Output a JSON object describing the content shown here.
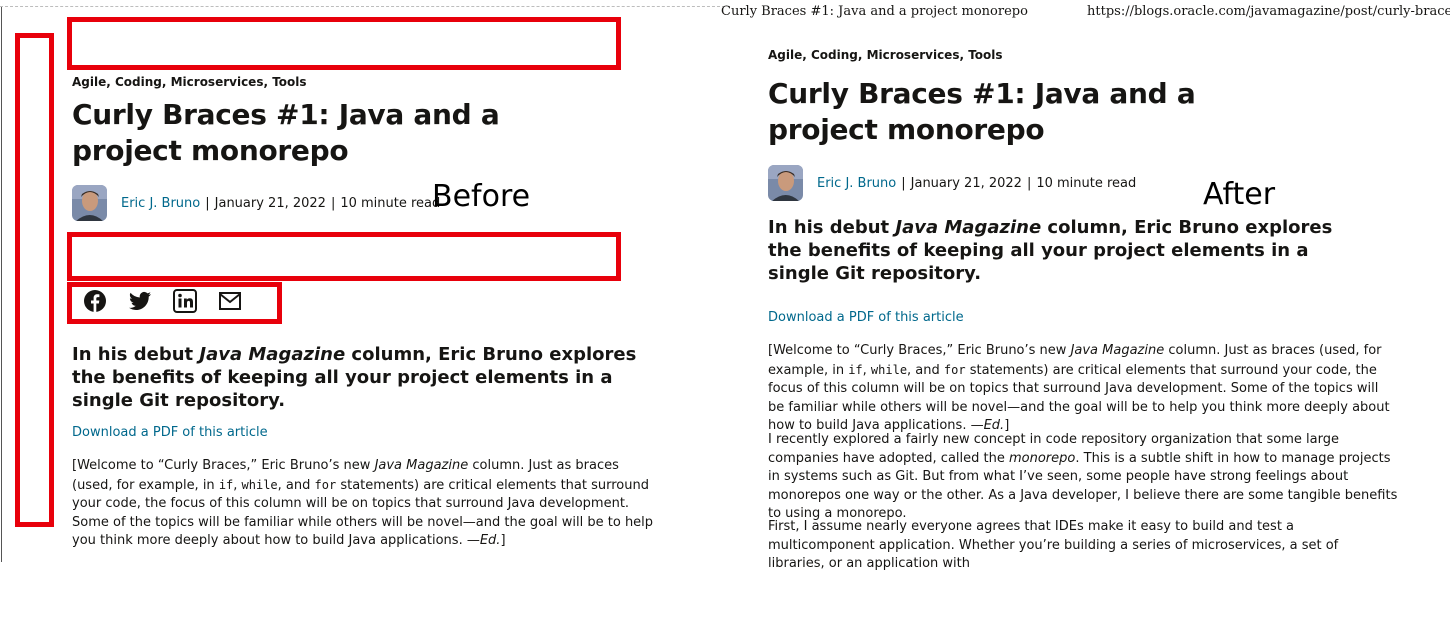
{
  "before": {
    "tags": "Agile, Coding, Microservices, Tools",
    "title": "Curly Braces #1: Java and a project monorepo",
    "author": "Eric J. Bruno",
    "date": "January 21, 2022",
    "read_time": "10 minute read",
    "separator": "|",
    "caption": "Before",
    "lede_pre": "In his debut ",
    "lede_em": "Java Magazine",
    "lede_post": " column, Eric Bruno explores the benefits of keeping all your project elements in a single Git repository.",
    "download": "Download a PDF of this article",
    "p1": {
      "a": "[Welcome to “Curly Braces,” Eric Bruno’s new ",
      "em1": "Java Magazine",
      "b": " column. Just as braces (used, for example, in ",
      "c1": "if",
      "c": ", ",
      "c2": "while",
      "d": ", and ",
      "c3": "for",
      "e": " statements) are critical elements that surround your code, the focus of this column will be on topics that surround Java development. Some of the topics will be familiar while others will be novel—and the goal will be to help you think more deeply about how to build Java applications. —",
      "em2": "Ed.",
      "f": "]"
    },
    "share_icons": [
      "facebook-icon",
      "twitter-icon",
      "linkedin-icon",
      "email-icon"
    ]
  },
  "after": {
    "window_title": "Curly Braces #1: Java and a project monorepo",
    "url": "https://blogs.oracle.com/javamagazine/post/curly-brace...",
    "tags": "Agile, Coding, Microservices, Tools",
    "title": "Curly Braces #1: Java and a project monorepo",
    "author": "Eric J. Bruno",
    "date": "January 21, 2022",
    "read_time": "10 minute read",
    "separator": "|",
    "caption": "After",
    "lede_pre": "In his debut ",
    "lede_em": "Java Magazine",
    "lede_post": " column, Eric Bruno explores the benefits of keeping all your project elements in a single Git repository.",
    "download": "Download a PDF of this article",
    "p1": {
      "a": "[Welcome to “Curly Braces,” Eric Bruno’s new ",
      "em1": "Java Magazine",
      "b": " column. Just as braces (used, for example, in ",
      "c1": "if",
      "c": ", ",
      "c2": "while",
      "d": ", and ",
      "c3": "for",
      "e": " statements) are critical elements that surround your code, the focus of this column will be on topics that surround Java development. Some of the topics will be familiar while others will be novel—and the goal will be to help you think more deeply about how to build Java applications. —",
      "em2": "Ed.",
      "f": "]"
    },
    "p2": {
      "a": "I recently explored a fairly new concept in code repository organization that some large companies have adopted, called the ",
      "em": "monorepo",
      "b": ". This is a subtle shift in how to manage projects in systems such as Git. But from what I’ve seen, some people have strong feelings about monorepos one way or the other. As a Java developer, I believe there are some tangible benefits to using a monorepo."
    },
    "p3": "First, I assume nearly everyone agrees that IDEs make it easy to build and test a multicomponent application. Whether you’re building a series of microservices, a set of libraries, or an application with"
  },
  "colors": {
    "highlight": "#e8000b",
    "link": "#00688c",
    "text": "#161513"
  }
}
